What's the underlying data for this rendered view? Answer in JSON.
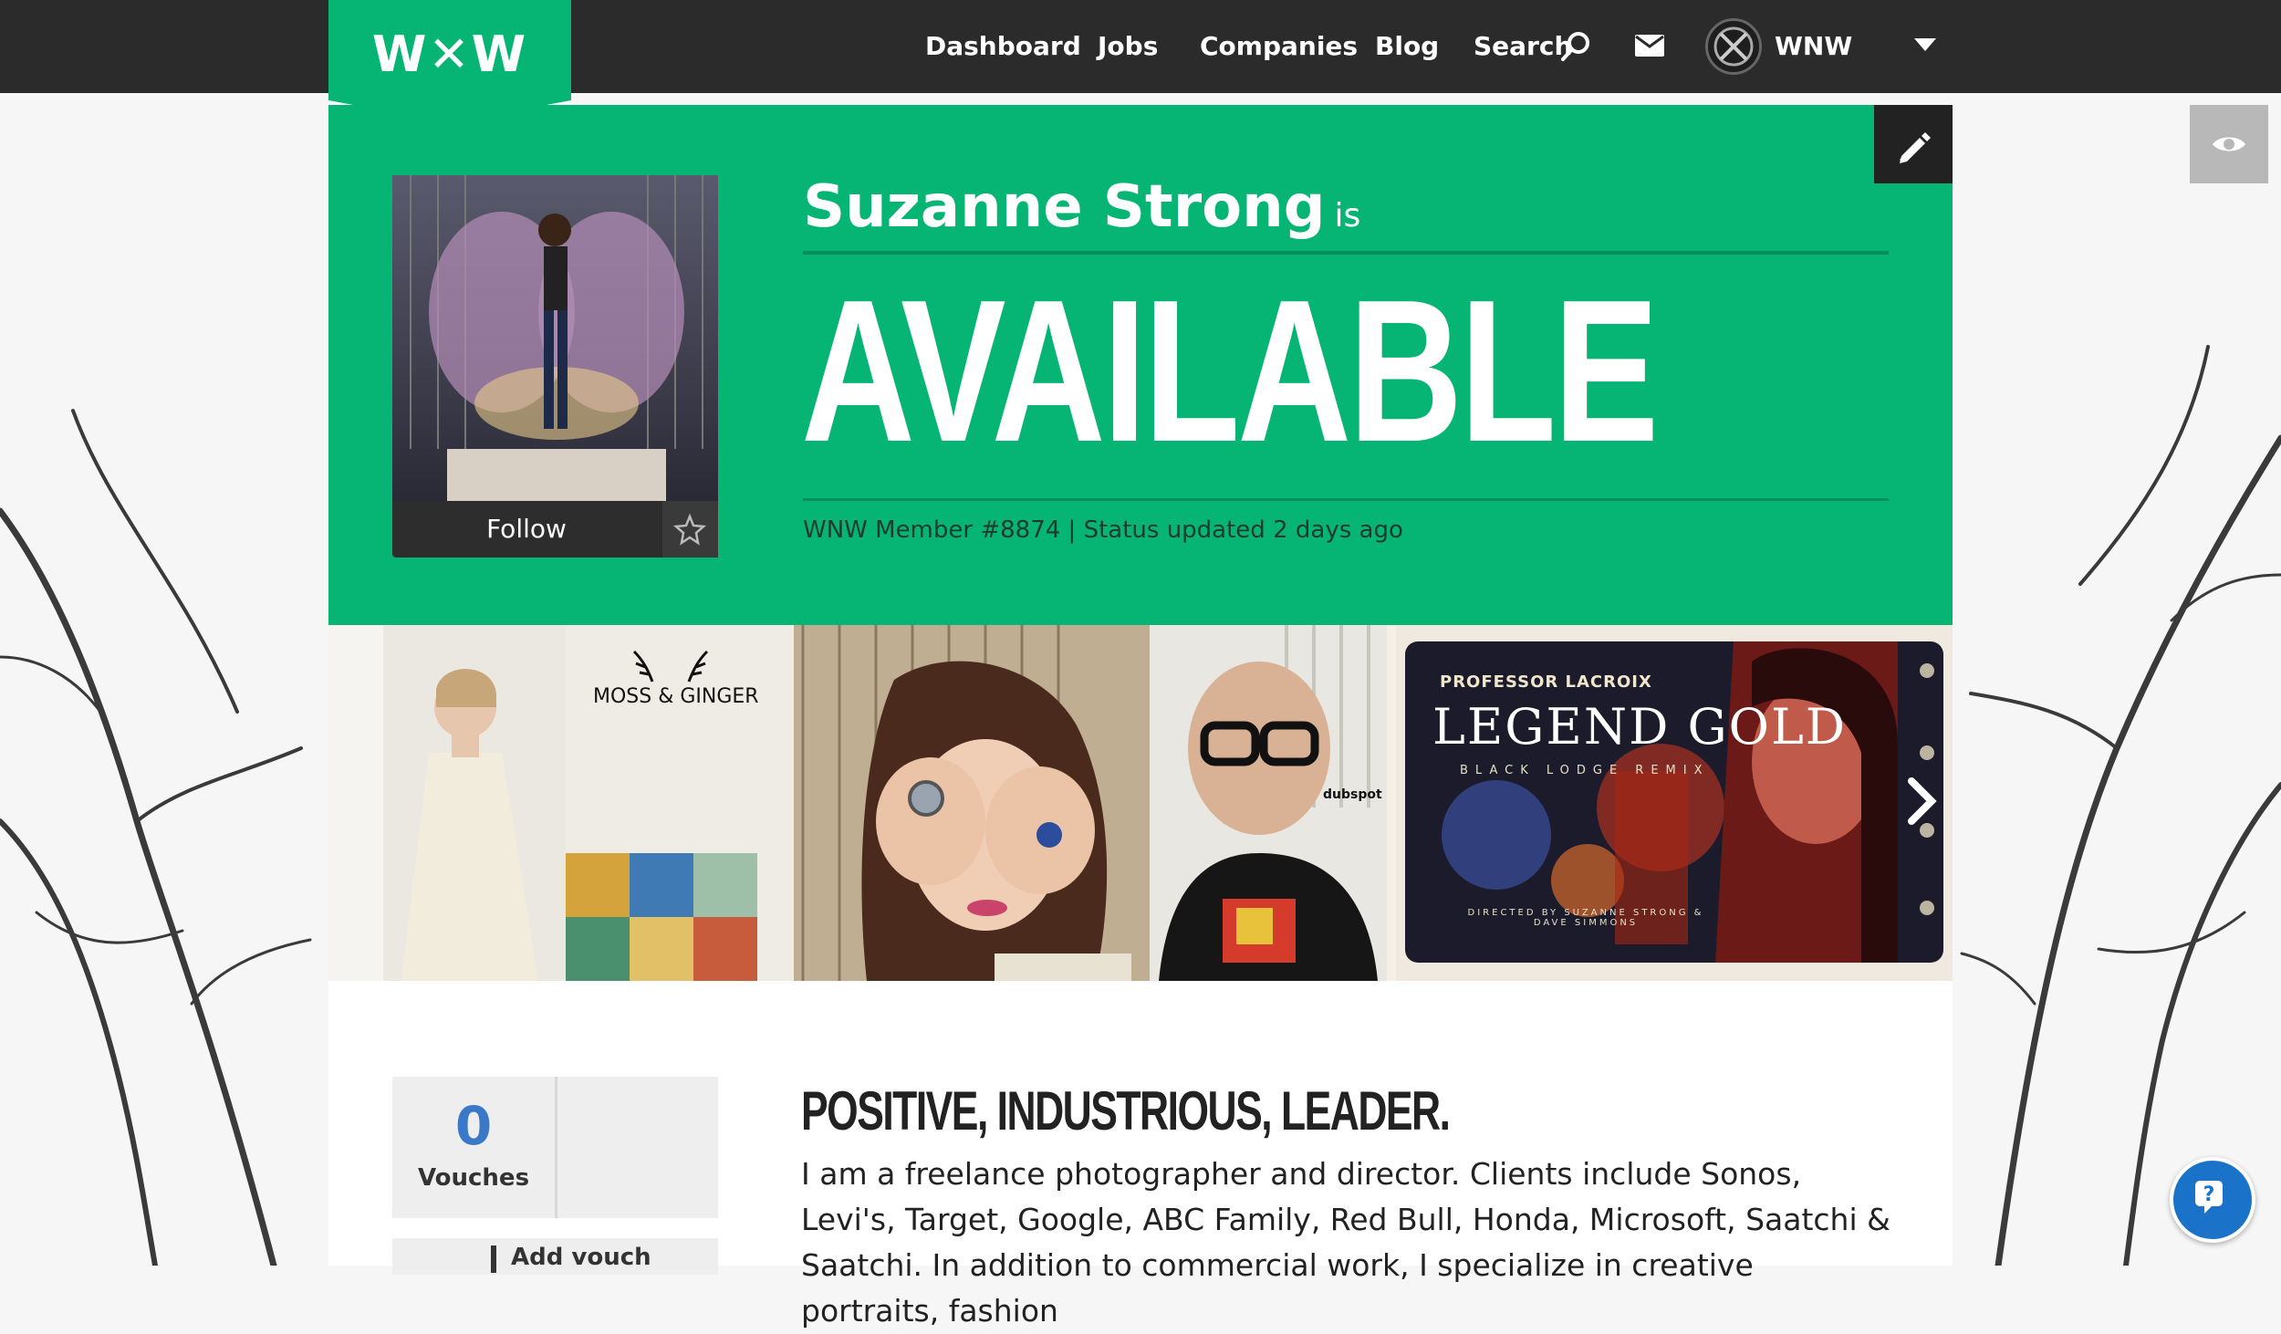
{
  "nav": {
    "logo": "W✕W",
    "links": [
      "Dashboard",
      "Jobs",
      "Companies",
      "Blog",
      "Search"
    ],
    "user_name": "WNW",
    "icons": {
      "search": "search-icon",
      "mail": "mail-icon",
      "dropdown": "chevron-down-icon"
    }
  },
  "profile": {
    "name": "Suzanne Strong",
    "connector": "is",
    "status": "AVAILABLE",
    "member_line": "WNW Member #8874 | Status updated 2 days ago",
    "follow_label": "Follow",
    "edit_icon": "pencil-icon",
    "view_icon": "eye-icon"
  },
  "gallery": {
    "tiles": [
      {
        "name": "portrait-white-dress"
      },
      {
        "name": "moss-and-ginger-jewelry",
        "caption": "MOSS & GINGER"
      },
      {
        "name": "portrait-glasses-man",
        "caption": "dubspot"
      },
      {
        "name": "legend-gold-poster",
        "caption": "PROFESSOR LACROIX",
        "title": "LEGEND GOLD",
        "sub": "BLACK LODGE REMIX",
        "credit": "DIRECTED BY SUZANNE STRONG & DAVE SIMMONS"
      }
    ],
    "next_icon": "chevron-right-icon"
  },
  "vouches": {
    "count": "0",
    "label": "Vouches",
    "add_label": "Add vouch"
  },
  "about": {
    "headline": "POSITIVE, INDUSTRIOUS, LEADER.",
    "bio": "I am a freelance photographer and director. Clients include Sonos, Levi's, Target, Google, ABC Family, Red Bull, Honda, Microsoft, Saatchi & Saatchi. In addition to commercial work, I specialize in creative portraits, fashion"
  },
  "colors": {
    "brand_green": "#06b574",
    "nav_dark": "#2b2b2b",
    "help_blue": "#1a73c9"
  }
}
